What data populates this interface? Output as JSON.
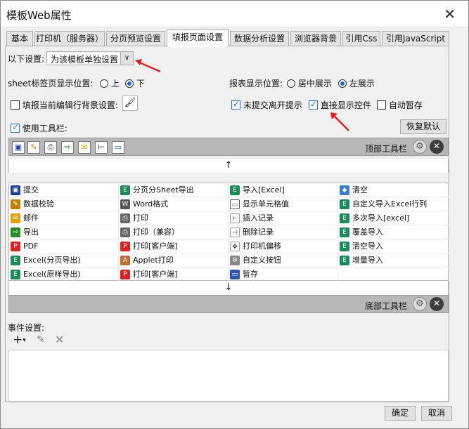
{
  "window": {
    "title": "模板Web属性"
  },
  "tabs": [
    {
      "label": "基本"
    },
    {
      "label": "打印机（服务器）"
    },
    {
      "label": "分页预览设置"
    },
    {
      "label": "填报页面设置"
    },
    {
      "label": "数据分析设置"
    },
    {
      "label": "浏览器背景"
    },
    {
      "label": "引用Css"
    },
    {
      "label": "引用JavaScript"
    }
  ],
  "settings": {
    "below_label": "以下设置:",
    "mode_value": "为该模板单独设置",
    "sheet_pos_label": "sheet标签页显示位置:",
    "sheet_top": "上",
    "sheet_bottom": "下",
    "report_pos_label": "报表显示位置:",
    "report_center": "居中展示",
    "report_left": "左展示",
    "row_bg_label": "填报当前编辑行背景设置:",
    "unsubmitted_label": "未提交离开提示",
    "direct_display_label": "直接显示控件",
    "autosave_label": "自动暂存",
    "use_toolbar_label": "使用工具栏:",
    "restore_default": "恢复默认"
  },
  "top_toolbar": {
    "label": "顶部工具栏"
  },
  "bottom_toolbar": {
    "label": "底部工具栏"
  },
  "arrows": {
    "up": "↑",
    "down": "↓"
  },
  "toolbar_items": [
    [
      "提交",
      "分页分Sheet导出",
      "导入[Excel]",
      "清空"
    ],
    [
      "数据校验",
      "Word格式",
      "显示单元格值",
      "自定义导入Excel行列"
    ],
    [
      "邮件",
      "打印",
      "插入记录",
      "多次导入[excel]"
    ],
    [
      "导出",
      "打印（兼容）",
      "删除记录",
      "覆盖导入"
    ],
    [
      "PDF",
      "打印[客户端]",
      "打印机偏移",
      "清空导入"
    ],
    [
      "Excel(分页导出)",
      "Applet打印",
      "自定义按钮",
      "增量导入"
    ],
    [
      "Excel(原样导出)",
      "打印[客户端]",
      "暂存",
      ""
    ]
  ],
  "events": {
    "label": "事件设置:"
  },
  "footer": {
    "ok": "确定",
    "cancel": "取消"
  },
  "colors": {
    "accent": "#1e6fd9",
    "red_arrow": "#e02020"
  }
}
